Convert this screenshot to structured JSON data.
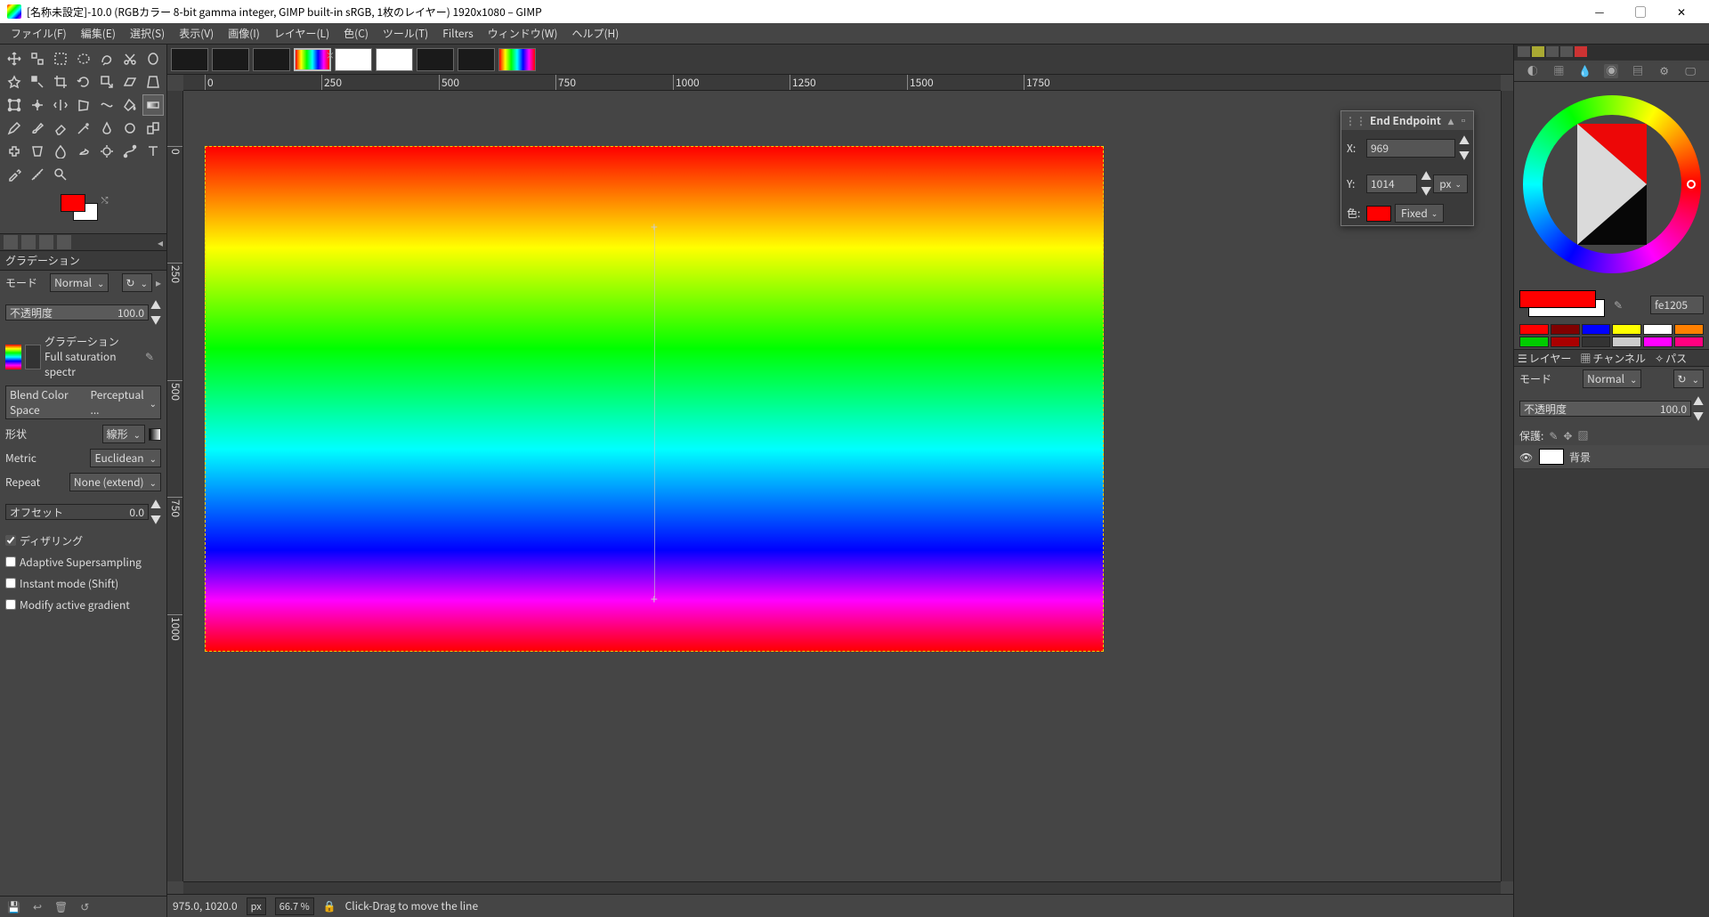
{
  "titlebar": {
    "title": "[名称未設定]-10.0 (RGBカラー 8-bit gamma integer, GIMP built-in sRGB, 1枚のレイヤー) 1920x1080 – GIMP"
  },
  "menu": {
    "file": "ファイル(F)",
    "edit": "編集(E)",
    "select": "選択(S)",
    "view": "表示(V)",
    "image": "画像(I)",
    "layer": "レイヤー(L)",
    "colors": "色(C)",
    "tools": "ツール(T)",
    "filters": "Filters",
    "windows": "ウィンドウ(W)",
    "help": "ヘルプ(H)"
  },
  "ruler": {
    "marks_h": [
      "0",
      "250",
      "500",
      "750",
      "1000",
      "1250",
      "1500",
      "1750"
    ],
    "marks_v": [
      "0",
      "250",
      "500",
      "750",
      "1000"
    ]
  },
  "tool_options": {
    "title": "グラデーション",
    "mode_label": "モード",
    "mode_value": "Normal",
    "opacity_label": "不透明度",
    "opacity_value": "100.0",
    "gradient_label": "グラデーション",
    "gradient_name": "Full saturation spectr",
    "blend_label": "Blend Color Space",
    "blend_value": "Perceptual ...",
    "shape_label": "形状",
    "shape_value": "線形",
    "metric_label": "Metric",
    "metric_value": "Euclidean",
    "repeat_label": "Repeat",
    "repeat_value": "None (extend)",
    "offset_label": "オフセット",
    "offset_value": "0.0",
    "dither_label": "ディザリング",
    "adaptive_label": "Adaptive Supersampling",
    "instant_label": "Instant mode  (Shift)",
    "modify_label": "Modify active gradient"
  },
  "endpoint": {
    "title": "End Endpoint",
    "x_label": "X:",
    "x_value": "969",
    "y_label": "Y:",
    "y_value": "1014",
    "unit": "px",
    "color_label": "色:",
    "fixed": "Fixed"
  },
  "right": {
    "hex": "fe1205",
    "palette": [
      "#ff0000",
      "#800000",
      "#0000ff",
      "#ffff00",
      "#ffffff",
      "#ff8000",
      "#00cc00",
      "#aa0000",
      "#333333",
      "#cccccc",
      "#ff00ff",
      "#ff0080"
    ],
    "tabs": {
      "layers": "レイヤー",
      "channels": "チャンネル",
      "paths": "パス"
    },
    "mode_label": "モード",
    "mode_value": "Normal",
    "opacity_label": "不透明度",
    "opacity_value": "100.0",
    "lock_label": "保護:",
    "layer_name": "背景"
  },
  "status": {
    "coords": "975.0, 1020.0",
    "unit": "px",
    "zoom": "66.7 %",
    "hint": "Click-Drag to move the line"
  }
}
